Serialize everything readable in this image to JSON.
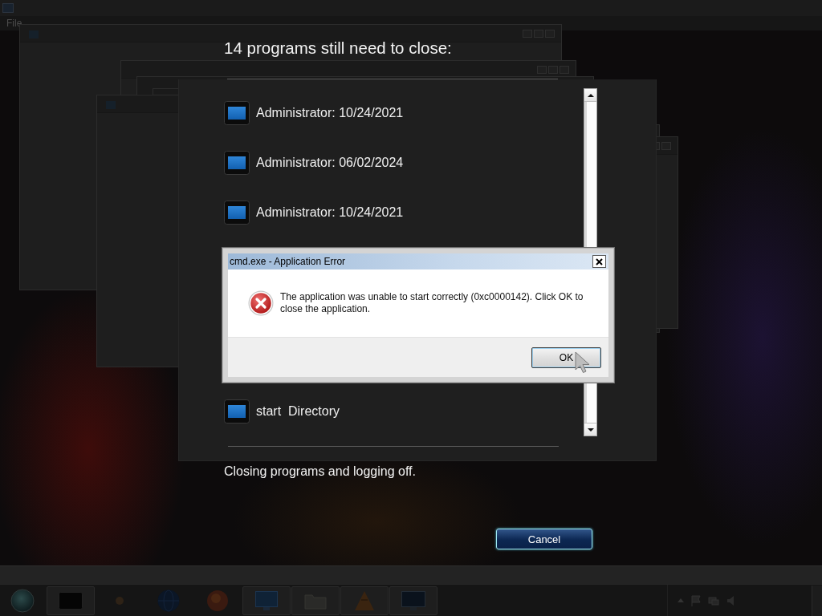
{
  "background_window": {
    "menu": [
      "File"
    ]
  },
  "logoff": {
    "heading": "14 programs still need to close:",
    "programs": [
      "Administrator: 10/24/2021",
      "Administrator: 06/02/2024",
      "Administrator: 10/24/2021",
      "start  Directory"
    ],
    "status": "Closing programs and logging off.",
    "cancel_button": "Cancel"
  },
  "error_dialog": {
    "title": "cmd.exe - Application Error",
    "message": "The application was unable to start correctly (0xc0000142). Click OK to close the application.",
    "buttons": [
      "OK"
    ]
  },
  "taskbar": {
    "items": [
      {
        "kind": "window",
        "running": true
      },
      {
        "kind": "dot",
        "running": false
      },
      {
        "kind": "globe",
        "running": false
      },
      {
        "kind": "ball",
        "running": false
      },
      {
        "kind": "screen",
        "running": true
      },
      {
        "kind": "folder",
        "running": true
      },
      {
        "kind": "cone",
        "running": true
      },
      {
        "kind": "monitor",
        "running": true
      }
    ]
  }
}
